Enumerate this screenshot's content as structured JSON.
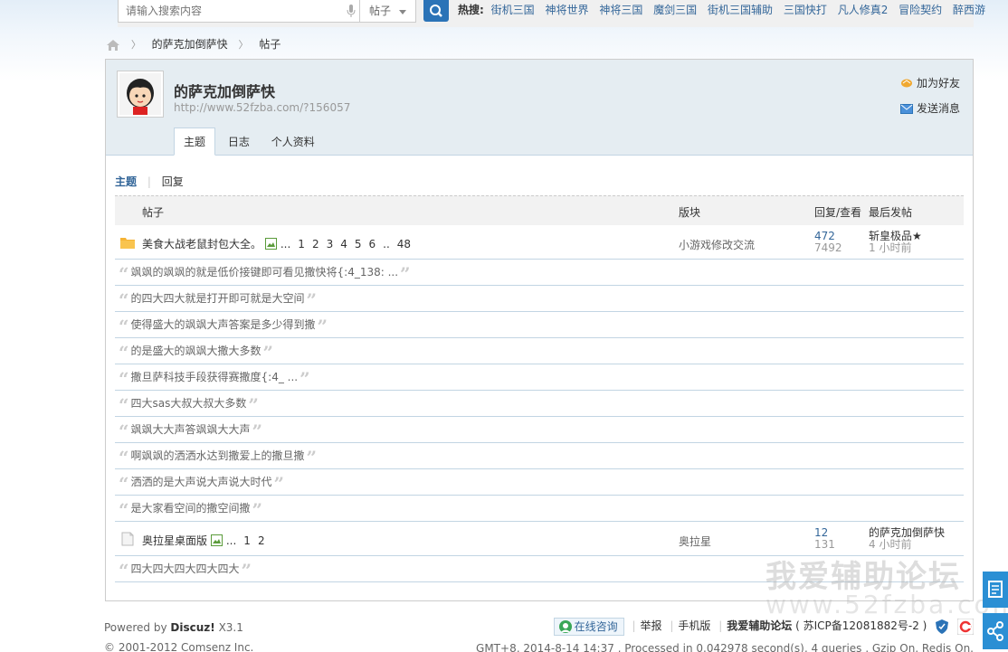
{
  "search": {
    "placeholder": "请输入搜索内容",
    "type": "帖子"
  },
  "hot": {
    "label": "热搜:",
    "items": [
      "街机三国",
      "神将世界",
      "神将三国",
      "魔剑三国",
      "街机三国辅助",
      "三国快打",
      "凡人修真2",
      "冒险契约",
      "醉西游"
    ]
  },
  "breadcrumb": {
    "user": "的萨克加倒萨快",
    "current": "帖子"
  },
  "profile": {
    "name": "的萨克加倒萨快",
    "url": "http://www.52fzba.com/?156057",
    "add_friend": "加为好友",
    "send_message": "发送消息",
    "tabs": [
      "主题",
      "日志",
      "个人资料"
    ]
  },
  "subtabs": {
    "topics": "主题",
    "replies": "回复"
  },
  "table": {
    "headers": {
      "title": "帖子",
      "forum": "版块",
      "reply_view": "回复/查看",
      "last_post": "最后发帖"
    },
    "threads": [
      {
        "title": "美食大战老鼠封包大全。",
        "pages": [
          "1",
          "2",
          "3",
          "4",
          "5",
          "6",
          "48"
        ],
        "ellipsis1": "...",
        "ellipsis2": "..",
        "forum": "小游戏修改交流",
        "replies": "472",
        "views": "7492",
        "last_user": "斩皇极品★",
        "last_time": "1 小时前",
        "quotes": [
          "飒飒的飒飒的就是低价接键即可看见撒快将{:4_138: ...",
          "的四大四大就是打开即可就是大空间",
          "使得盛大的飒飒大声答案是多少得到撒",
          "的是盛大的飒飒大撒大多数",
          "撒旦萨科技手段获得赛撒度{:4_ ...",
          "四大sas大叔大叔大多数",
          "飒飒大大声答飒飒大大声",
          "啊飒飒的洒洒水达到撒爱上的撒旦撒",
          "洒洒的是大声说大声说大时代",
          "是大家看空间的撒空间撒"
        ]
      },
      {
        "title": "奥拉星桌面版",
        "pages": [
          "1",
          "2"
        ],
        "ellipsis1": "...",
        "forum": "奥拉星",
        "replies": "12",
        "views": "131",
        "last_user": "的萨克加倒萨快",
        "last_time": "4 小时前",
        "quotes": [
          "四大四大四大四大四大"
        ]
      }
    ]
  },
  "footer": {
    "powered_prefix": "Powered by",
    "powered_brand": "Discuz!",
    "powered_version": "X3.1",
    "copyright": "© 2001-2012 Comsenz Inc.",
    "online": "在线咨询",
    "links": [
      "举报",
      "手机版",
      "我爱辅助论坛",
      "( 苏ICP备12081882号-2 )"
    ],
    "stats": "GMT+8, 2014-8-14 14:37 , Processed in 0.042978 second(s), 4 queries , Gzip On, Redis On."
  },
  "watermark": {
    "text": "我爱辅助论坛",
    "url": "www.52fzba.com"
  },
  "colors": {
    "accent": "#336699",
    "search_button": "#2b73b7",
    "profile_bg": "#e5edf2",
    "border": "#c2d5e3"
  }
}
